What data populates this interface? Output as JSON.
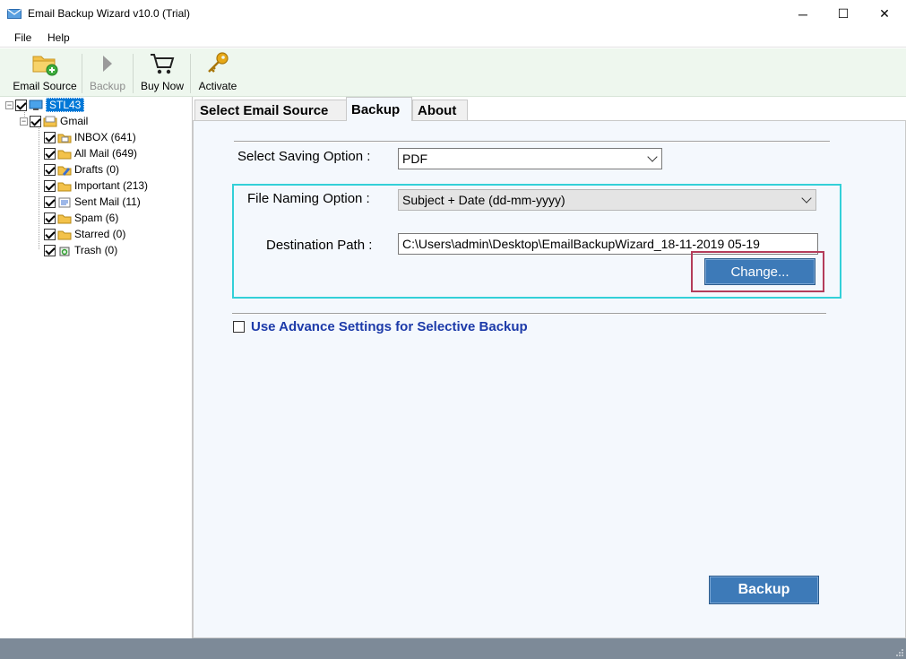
{
  "window": {
    "title": "Email Backup Wizard v10.0 (Trial)",
    "minimize": "─",
    "maximize": "☐",
    "close": "✕"
  },
  "menu": {
    "file": "File",
    "help": "Help"
  },
  "toolbar": {
    "email_source": "Email Source",
    "backup": "Backup",
    "buy_now": "Buy Now",
    "activate": "Activate"
  },
  "tree": {
    "root": "STL43",
    "account": "Gmail",
    "folders": [
      {
        "label": "INBOX (641)",
        "icon": "inbox-folder-icon"
      },
      {
        "label": "All Mail (649)",
        "icon": "folder-icon"
      },
      {
        "label": "Drafts (0)",
        "icon": "drafts-folder-icon"
      },
      {
        "label": "Important (213)",
        "icon": "folder-icon"
      },
      {
        "label": "Sent Mail (11)",
        "icon": "sent-folder-icon"
      },
      {
        "label": "Spam (6)",
        "icon": "folder-icon"
      },
      {
        "label": "Starred (0)",
        "icon": "folder-icon"
      },
      {
        "label": "Trash (0)",
        "icon": "trash-icon"
      }
    ]
  },
  "tabs": {
    "select_source": "Select Email Source",
    "backup": "Backup",
    "about": "About"
  },
  "backup_panel": {
    "saving_label": "Select Saving Option  :",
    "saving_value": "PDF",
    "naming_label": "File Naming Option  :",
    "naming_value": "Subject + Date (dd-mm-yyyy)",
    "dest_label": "Destination Path  :",
    "dest_value": "C:\\Users\\admin\\Desktop\\EmailBackupWizard_18-11-2019 05-19",
    "change_button": "Change...",
    "advance_label": "Use Advance Settings for Selective Backup",
    "backup_button": "Backup"
  },
  "colors": {
    "accent_blue": "#3d7ab8",
    "highlight_cyan": "#33d0d8",
    "highlight_red": "#b43c5a",
    "link_blue": "#1c3aa9",
    "status_bar": "#7d8a98"
  }
}
